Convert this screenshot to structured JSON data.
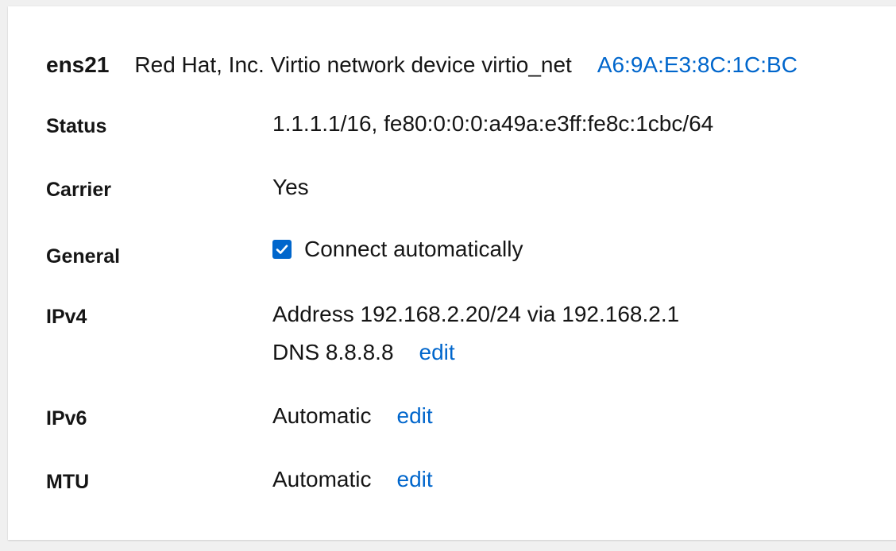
{
  "interface": {
    "name": "ens21",
    "description": "Red Hat, Inc. Virtio network device virtio_net",
    "mac": "A6:9A:E3:8C:1C:BC"
  },
  "rows": {
    "status": {
      "label": "Status",
      "value": "1.1.1.1/16, fe80:0:0:0:a49a:e3ff:fe8c:1cbc/64"
    },
    "carrier": {
      "label": "Carrier",
      "value": "Yes"
    },
    "general": {
      "label": "General",
      "checkbox_label": "Connect automatically",
      "checked": true
    },
    "ipv4": {
      "label": "IPv4",
      "address": "Address 192.168.2.20/24 via 192.168.2.1",
      "dns": "DNS 8.8.8.8",
      "edit_label": "edit"
    },
    "ipv6": {
      "label": "IPv6",
      "value": "Automatic",
      "edit_label": "edit"
    },
    "mtu": {
      "label": "MTU",
      "value": "Automatic",
      "edit_label": "edit"
    }
  },
  "colors": {
    "link": "#0066cc",
    "checkbox": "#0066cc"
  },
  "icons": {
    "checkbox": "checkmark-icon"
  }
}
